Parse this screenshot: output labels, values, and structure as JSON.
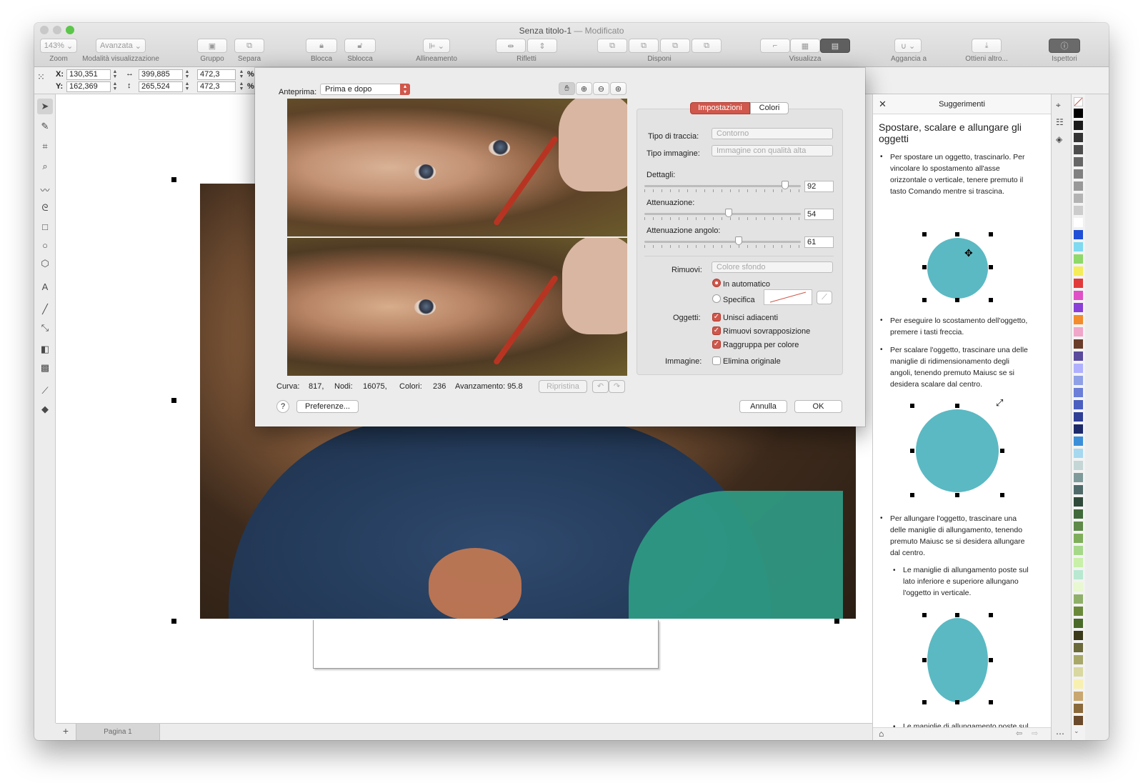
{
  "window": {
    "title": "Senza titolo-1",
    "title_suffix": "— Modificato"
  },
  "toolbar": {
    "zoom_value": "143%",
    "view_mode_value": "Avanzata",
    "labels": {
      "zoom": "Zoom",
      "view_mode": "Modalità visualizzazione",
      "group": "Gruppo",
      "ungroup": "Separa",
      "lock": "Blocca",
      "unlock": "Sblocca",
      "align": "Allineamento",
      "mirror": "Rifletti",
      "arrange": "Disponi",
      "view": "Visualizza",
      "snap": "Aggancia a",
      "more": "Ottieni altro...",
      "inspectors": "Ispettori"
    }
  },
  "propbar": {
    "x_label": "X:",
    "y_label": "Y:",
    "x_value": "130,351",
    "y_value": "162,369",
    "w_value": "399,885",
    "h_value": "265,524",
    "sw_value": "472,3",
    "sh_value": "472,3",
    "pct": "%"
  },
  "dialog": {
    "preview_label": "Anteprima:",
    "preview_mode": "Prima e dopo",
    "tabs": {
      "settings": "Impostazioni",
      "colors": "Colori"
    },
    "trace_type_label": "Tipo di traccia:",
    "trace_type_value": "Contorno",
    "image_type_label": "Tipo immagine:",
    "image_type_value": "Immagine con qualità alta",
    "details_label": "Dettagli:",
    "details_value": "92",
    "smoothing_label": "Attenuazione:",
    "smoothing_value": "54",
    "corner_label": "Attenuazione angolo:",
    "corner_value": "61",
    "slider_levels": {
      "details": 0.92,
      "smoothing": 0.54,
      "corner": 0.61
    },
    "remove_label": "Rimuovi:",
    "remove_value": "Colore sfondo",
    "auto_label": "In automatico",
    "specific_label": "Specifica",
    "objects_label": "Oggetti:",
    "merge_label": "Unisci adiacenti",
    "overlap_label": "Rimuovi sovrapposizione",
    "group_color_label": "Raggruppa per colore",
    "image_label": "Immagine:",
    "delete_orig_label": "Elimina originale",
    "stats": {
      "curves_label": "Curva:",
      "curves_value": "817,",
      "nodes_label": "Nodi:",
      "nodes_value": "16075,",
      "colors_label": "Colori:",
      "colors_value": "236",
      "progress_label": "Avanzamento: 95.8"
    },
    "reset_label": "Ripristina",
    "help_label": "?",
    "prefs_label": "Preferenze...",
    "cancel_label": "Annulla",
    "ok_label": "OK"
  },
  "hints": {
    "title": "Suggerimenti",
    "heading": "Spostare, scalare e allungare gli oggetti",
    "p1": "Per spostare un oggetto, trascinarlo. Per vincolare lo spostamento all'asse orizzontale o verticale, tenere premuto il tasto Comando mentre si trascina.",
    "p2": "Per eseguire lo scostamento dell'oggetto, premere i tasti freccia.",
    "p3": "Per scalare l'oggetto, trascinare una delle maniglie di ridimensionamento degli angoli, tenendo premuto Maiusc se si desidera scalare dal centro.",
    "p4": "Per allungare l'oggetto, trascinare una delle maniglie di allungamento, tenendo premuto Maiusc se si desidera allungare dal centro.",
    "p5": "Le maniglie di allungamento poste sul lato inferiore e superiore allungano l'oggetto in verticale.",
    "p6": "Le maniglie di allungamento poste sul"
  },
  "page": {
    "tab_label": "Pagina 1",
    "add_label": "+"
  },
  "colors": {
    "accent": "#d0574b",
    "circle": "#5bb9c3",
    "palette": [
      "#000000",
      "#1a1a1a",
      "#333333",
      "#4d4d4d",
      "#666666",
      "#808080",
      "#999999",
      "#b3b3b3",
      "#cccccc",
      "#ffffff",
      "#1f4fd6",
      "#7fd9f0",
      "#8fd86a",
      "#f4ec5b",
      "#e23a3a",
      "#e04fc6",
      "#8a3fd6",
      "#f28c2c",
      "#f0a6c8",
      "#6a3d2a",
      "#5a4a9c",
      "#b0b0ff",
      "#8fa0e6",
      "#6b7fd8",
      "#4a5fc0",
      "#2f3f96",
      "#1d2a6a",
      "#3a8fd8",
      "#a6d8f0",
      "#c4d6d6",
      "#7f9a9a",
      "#4f6a6a",
      "#2f4a3a",
      "#3f6a3a",
      "#5f8a4a",
      "#7fae5a",
      "#a6d88a",
      "#c8f0a8",
      "#b8e8d0",
      "#e8f8d0",
      "#8fb06a",
      "#6a8a3a",
      "#4a6a2a",
      "#3a3a1a",
      "#6a6a3a",
      "#a8a86a",
      "#d8d8a0",
      "#f8f0b0",
      "#c8a870",
      "#8a6a3a",
      "#6a4a2a"
    ]
  }
}
